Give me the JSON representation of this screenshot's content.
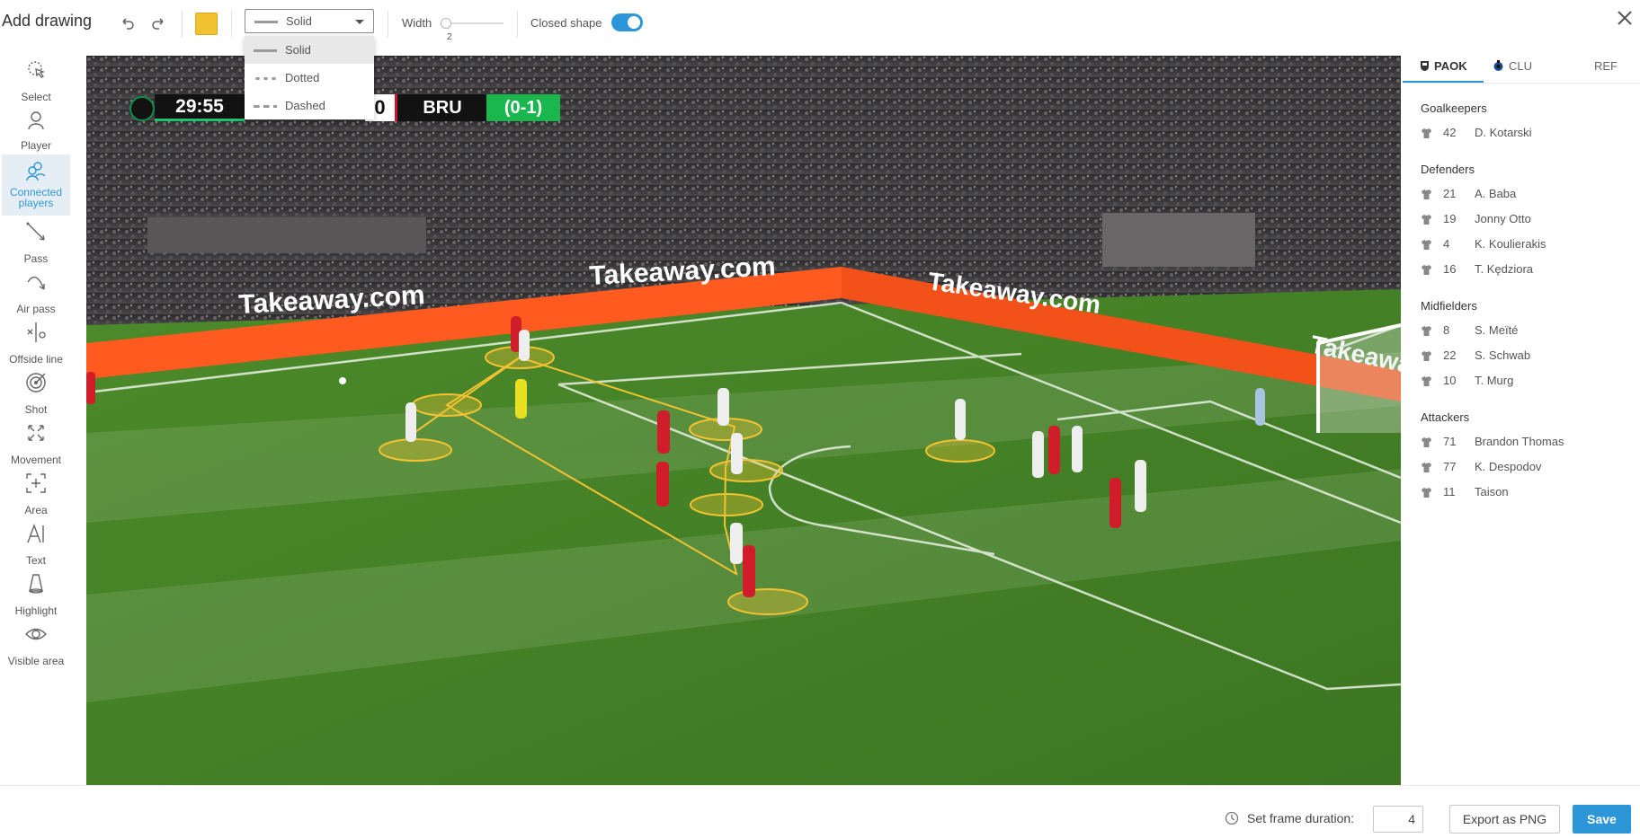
{
  "header": {
    "title": "Add drawing",
    "line_style": {
      "selected": "Solid",
      "options": [
        "Solid",
        "Dotted",
        "Dashed"
      ]
    },
    "width": {
      "label": "Width",
      "value": "2",
      "fraction": 0.05
    },
    "closed_shape": {
      "label": "Closed shape",
      "on": true
    },
    "color": "#f2c232"
  },
  "tools": [
    {
      "label": "Select",
      "icon": "cursor-icon"
    },
    {
      "label": "Player",
      "icon": "player-icon"
    },
    {
      "label": "Connected players",
      "icon": "connected-players-icon",
      "active": true
    },
    {
      "label": "Pass",
      "icon": "pass-icon"
    },
    {
      "label": "Air pass",
      "icon": "air-pass-icon"
    },
    {
      "label": "Offside line",
      "icon": "offside-line-icon"
    },
    {
      "label": "Shot",
      "icon": "shot-icon"
    },
    {
      "label": "Movement",
      "icon": "movement-icon"
    },
    {
      "label": "Area",
      "icon": "area-icon"
    },
    {
      "label": "Text",
      "icon": "text-icon"
    },
    {
      "label": "Highlight",
      "icon": "highlight-icon"
    },
    {
      "label": "Visible area",
      "icon": "eye-icon"
    }
  ],
  "scoreboard": {
    "time": "29:55",
    "score": "0",
    "team": "BRU",
    "aggregate": "(0-1)"
  },
  "ad_boards": [
    "Takeaway.com",
    "Takeaway.com",
    "Takeaway.com",
    "Takeaway"
  ],
  "roster": {
    "tabs": [
      "PAOK",
      "CLU",
      "REF"
    ],
    "active_tab": "PAOK",
    "groups": [
      {
        "title": "Goalkeepers",
        "players": [
          {
            "num": "42",
            "name": "D. Kotarski"
          }
        ]
      },
      {
        "title": "Defenders",
        "players": [
          {
            "num": "21",
            "name": "A. Baba"
          },
          {
            "num": "19",
            "name": "Jonny Otto"
          },
          {
            "num": "4",
            "name": "K. Koulierakis"
          },
          {
            "num": "16",
            "name": "T. Kędziora"
          }
        ]
      },
      {
        "title": "Midfielders",
        "players": [
          {
            "num": "8",
            "name": "S. Meïté"
          },
          {
            "num": "22",
            "name": "S. Schwab"
          },
          {
            "num": "10",
            "name": "T. Murg"
          }
        ]
      },
      {
        "title": "Attackers",
        "players": [
          {
            "num": "71",
            "name": "Brandon Thomas"
          },
          {
            "num": "77",
            "name": "K. Despodov"
          },
          {
            "num": "11",
            "name": "Taison"
          }
        ]
      }
    ]
  },
  "footer": {
    "duration_label": "Set frame duration:",
    "duration_value": "4",
    "export_label": "Export as PNG",
    "save_label": "Save"
  },
  "colors": {
    "accent": "#2d96d8",
    "drawing": "#f2c232",
    "pitch": "#3f7c22"
  }
}
